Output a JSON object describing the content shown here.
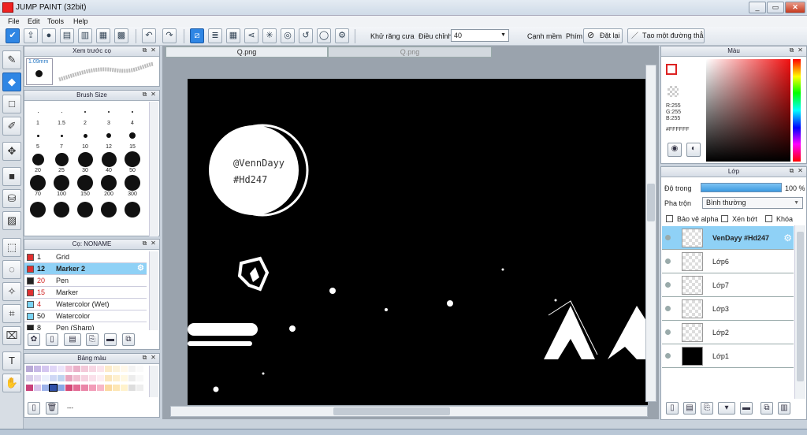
{
  "window": {
    "title": "JUMP PAINT (32bit)",
    "min": "_",
    "max": "▭",
    "close": "✕"
  },
  "menu": [
    "File",
    "Edit",
    "Tools",
    "Help"
  ],
  "toolbar": {
    "antialias_label": "Khử răng cưa",
    "adjust_label": "Điều chỉnh",
    "adjust_value": "40",
    "soft_edge_label": "Cạnh mềm",
    "key_label": "Phím",
    "reset_label": "Đặt lại",
    "make_line_label": "Tạo một đường thẳng"
  },
  "brush_preview": {
    "title": "Xem trước cọ",
    "size_text": "1.09mm"
  },
  "brush_size": {
    "title": "Brush Size",
    "sizes": [
      [
        {
          "l": "1",
          "d": 1
        },
        {
          "l": "1.5",
          "d": 1
        },
        {
          "l": "2",
          "d": 2
        },
        {
          "l": "3",
          "d": 2
        },
        {
          "l": "4",
          "d": 2
        }
      ],
      [
        {
          "l": "5",
          "d": 3
        },
        {
          "l": "7",
          "d": 3
        },
        {
          "l": "10",
          "d": 5
        },
        {
          "l": "12",
          "d": 6
        },
        {
          "l": "15",
          "d": 8
        }
      ],
      [
        {
          "l": "20",
          "d": 15
        },
        {
          "l": "25",
          "d": 17
        },
        {
          "l": "30",
          "d": 19
        },
        {
          "l": "40",
          "d": 19
        },
        {
          "l": "50",
          "d": 20
        }
      ],
      [
        {
          "l": "70",
          "d": 20
        },
        {
          "l": "100",
          "d": 20
        },
        {
          "l": "150",
          "d": 20
        },
        {
          "l": "200",
          "d": 20
        },
        {
          "l": "300",
          "d": 20
        }
      ],
      [
        {
          "l": "",
          "d": 20
        },
        {
          "l": "",
          "d": 20
        },
        {
          "l": "",
          "d": 20
        },
        {
          "l": "",
          "d": 20
        },
        {
          "l": "",
          "d": 20
        }
      ]
    ]
  },
  "brushes": {
    "title": "Cọ: NONAME",
    "items": [
      {
        "color": "#e03030",
        "num": "1",
        "name": "Grid",
        "numColor": "#111"
      },
      {
        "color": "#e03030",
        "num": "12",
        "name": "Marker 2",
        "numColor": "#111"
      },
      {
        "color": "#222222",
        "num": "20",
        "name": "Pen",
        "numColor": "#d02020"
      },
      {
        "color": "#e03030",
        "num": "15",
        "name": "Marker",
        "numColor": "#d02020"
      },
      {
        "color": "#7ad4f4",
        "num": "4",
        "name": "Watercolor (Wet)",
        "numColor": "#d02020"
      },
      {
        "color": "#7ad4f4",
        "num": "50",
        "name": "Watercolor",
        "numColor": "#111"
      },
      {
        "color": "#222222",
        "num": "8",
        "name": "Pen (Sharp)",
        "numColor": "#111"
      }
    ]
  },
  "palette": {
    "title": "Bảng màu",
    "footer": "---"
  },
  "document": {
    "tab_active": "Q.png",
    "tab_inactive": "Q.png"
  },
  "artwork": {
    "line1": "@VennDayy",
    "line2": "#Hd247"
  },
  "color_panel": {
    "title": "Màu",
    "r": "R:255",
    "g": "G:255",
    "b": "B:255",
    "hex": "#FFFFFF"
  },
  "layers": {
    "title": "Lớp",
    "opacity_label": "Độ trong",
    "opacity_value": "100 %",
    "opacity": 1.0,
    "blend_label": "Pha trộn",
    "blend_value": "Bình thường",
    "protect_alpha": "Bảo vệ alpha",
    "clip": "Xén bớt",
    "lock": "Khóa",
    "items": [
      {
        "name": "VenDayy #Hd247",
        "selected": true,
        "dark": false
      },
      {
        "name": "Lớp6",
        "selected": false,
        "dark": false
      },
      {
        "name": "Lớp7",
        "selected": false,
        "dark": false
      },
      {
        "name": "Lớp3",
        "selected": false,
        "dark": false
      },
      {
        "name": "Lớp2",
        "selected": false,
        "dark": false
      },
      {
        "name": "Lớp1",
        "selected": false,
        "dark": true
      }
    ]
  }
}
